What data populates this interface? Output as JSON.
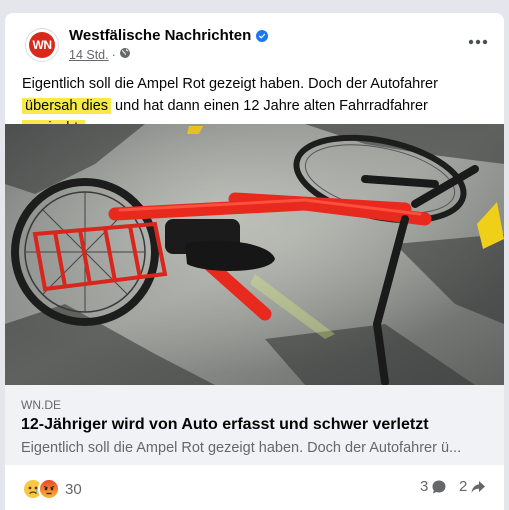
{
  "post": {
    "page_name": "Westfälische Nachrichten",
    "logo_text": "WN",
    "timestamp": "14 Std.",
    "separator": "·",
    "text_parts": [
      "Eigentlich soll die Ampel Rot gezeigt haben. Doch der Autofahrer ",
      "übersah dies",
      " und hat dann einen 12 Jahre alten Fahrradfahrer ",
      "erwischt."
    ],
    "highlight_color": "#f7e94a"
  },
  "link": {
    "domain": "WN.DE",
    "title": "12-Jähriger wird von Auto erfasst und schwer verletzt",
    "description": "Eigentlich soll die Ampel Rot gezeigt haben. Doch der Autofahrer ü..."
  },
  "stats": {
    "reaction_count": "30",
    "comment_count": "3",
    "share_count": "2"
  },
  "icons": {
    "verified": "verified-badge-icon",
    "audience": "globe-icon",
    "more": "more-options-icon",
    "comment": "comment-icon",
    "share": "share-icon",
    "reactions": [
      "sad-reaction-icon",
      "angry-reaction-icon"
    ]
  },
  "colors": {
    "brand_red": "#d72a1c",
    "verified_blue": "#1877f2",
    "secondary_text": "#65676b"
  }
}
